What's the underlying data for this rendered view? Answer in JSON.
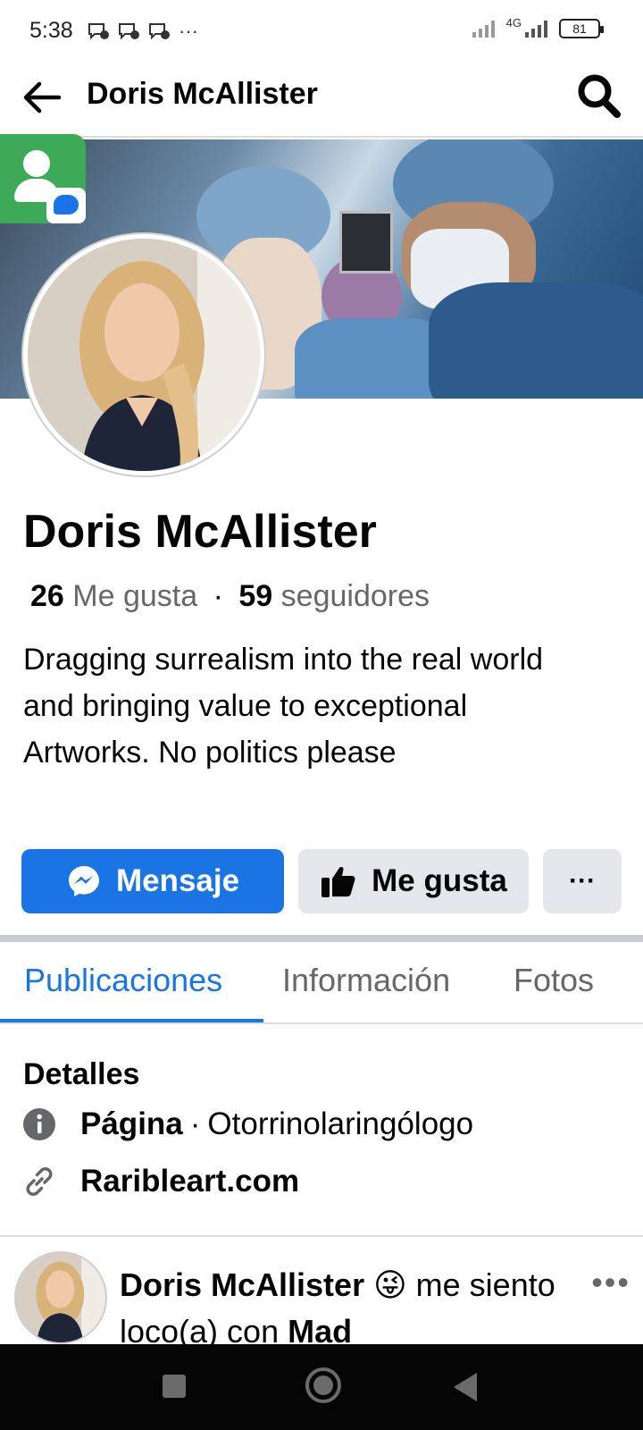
{
  "status_bar": {
    "time": "5:38",
    "notification_icons": [
      "notification-icon",
      "notification-icon",
      "notification-icon"
    ],
    "more_dots": "···",
    "network": "4G",
    "battery": "81"
  },
  "header": {
    "title": "Doris McAllister",
    "back_icon": "arrow-left-icon",
    "search_icon": "search-icon"
  },
  "profile": {
    "name": "Doris McAllister",
    "likes_count": "26",
    "likes_label": "Me gusta",
    "dot": "·",
    "followers_count": "59",
    "followers_label": "seguidores",
    "bio": "Dragging surrealism into the real world and bringing value to exceptional Artworks. No politics please"
  },
  "actions": {
    "message_label": "Mensaje",
    "like_label": "Me gusta",
    "more_label": "···"
  },
  "tabs": [
    {
      "label": "Publicaciones",
      "active": true
    },
    {
      "label": "Información",
      "active": false
    },
    {
      "label": "Fotos",
      "active": false
    }
  ],
  "details": {
    "title": "Detalles",
    "page_type_label": "Página",
    "separator": "·",
    "page_category": "Otorrinolaringólogo",
    "website": "Raribleart.com"
  },
  "post": {
    "author": "Doris McAllister",
    "emoji": "😜",
    "text_line1_rest": "me",
    "text_line2": "siento loco(a) con",
    "tagged": "Mad",
    "more": "•••"
  },
  "colors": {
    "accent": "#1b74e4",
    "button_gray": "#e4e6eb",
    "secondary_text": "#65676b"
  }
}
